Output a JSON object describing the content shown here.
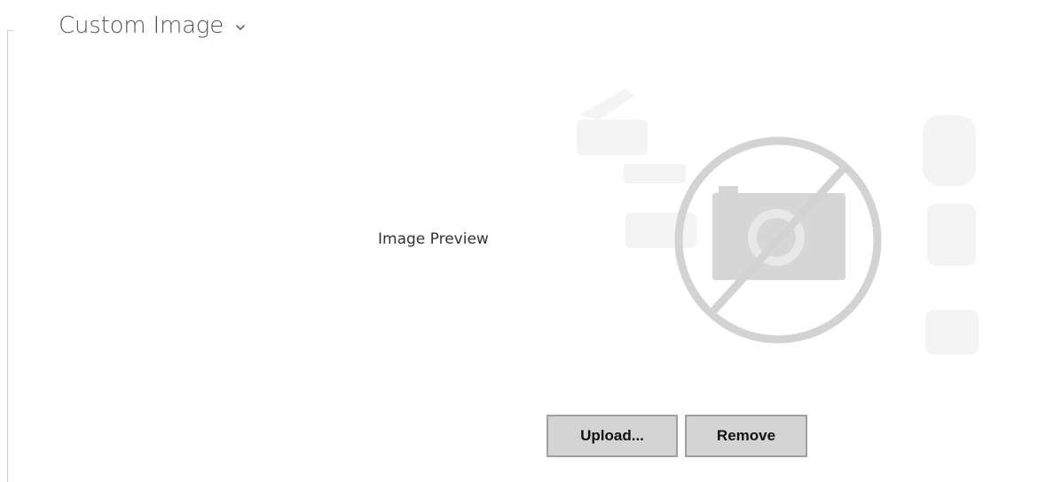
{
  "section": {
    "title": "Custom Image",
    "toggle_icon": "chevron-down-icon"
  },
  "preview": {
    "label": "Image Preview",
    "placeholder_icon": "no-image-icon"
  },
  "actions": {
    "upload_label": "Upload...",
    "remove_label": "Remove"
  },
  "colors": {
    "button_bg": "#d4d4d4",
    "button_border": "#a0a0a0",
    "placeholder_gray": "#d3d3d3",
    "title_text": "#545454"
  }
}
